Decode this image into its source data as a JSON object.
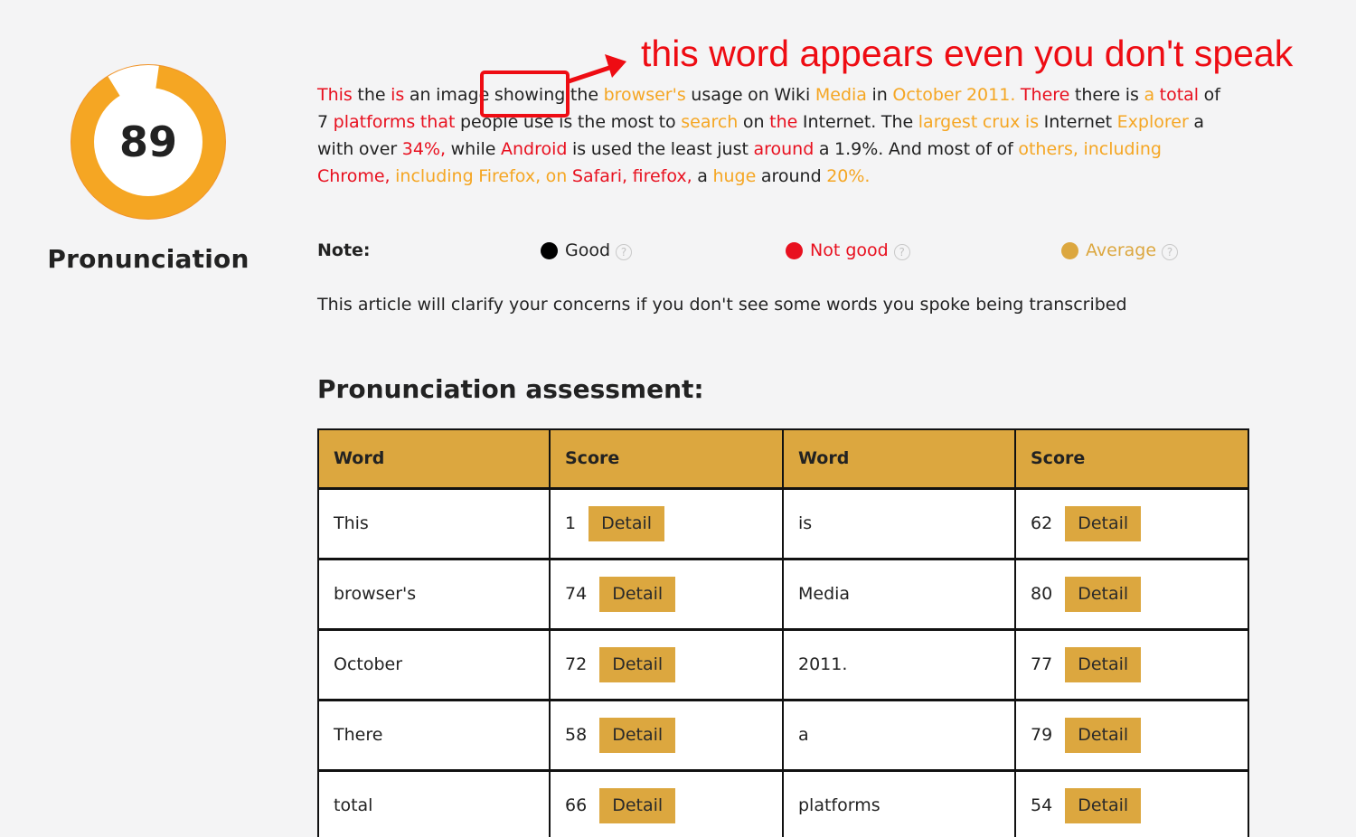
{
  "score": {
    "value": "89",
    "fraction": 0.89,
    "label": "Pronunciation",
    "ring_color": "#f5a623"
  },
  "transcript": [
    {
      "t": "This",
      "c": "red"
    },
    {
      "t": "the",
      "c": "normal"
    },
    {
      "t": "is",
      "c": "red"
    },
    {
      "t": "an",
      "c": "normal"
    },
    {
      "t": "image",
      "c": "normal"
    },
    {
      "t": "showing",
      "c": "normal"
    },
    {
      "t": "the",
      "c": "normal"
    },
    {
      "t": "browser's",
      "c": "orange"
    },
    {
      "t": "usage",
      "c": "normal"
    },
    {
      "t": "on",
      "c": "normal"
    },
    {
      "t": "Wiki",
      "c": "normal"
    },
    {
      "t": "Media",
      "c": "orange"
    },
    {
      "t": "in",
      "c": "normal"
    },
    {
      "t": "October",
      "c": "orange"
    },
    {
      "t": "2011.",
      "c": "orange"
    },
    {
      "t": "There",
      "c": "red"
    },
    {
      "t": "there",
      "c": "normal"
    },
    {
      "t": "is",
      "c": "normal"
    },
    {
      "t": "a",
      "c": "orange"
    },
    {
      "t": "total",
      "c": "red"
    },
    {
      "t": "of",
      "c": "normal"
    },
    {
      "t": "7",
      "c": "normal"
    },
    {
      "t": "platforms",
      "c": "red"
    },
    {
      "t": "that",
      "c": "red"
    },
    {
      "t": "people",
      "c": "normal"
    },
    {
      "t": "use",
      "c": "normal"
    },
    {
      "t": "is",
      "c": "normal"
    },
    {
      "t": "the",
      "c": "normal"
    },
    {
      "t": "most",
      "c": "normal"
    },
    {
      "t": "to",
      "c": "normal"
    },
    {
      "t": "search",
      "c": "orange"
    },
    {
      "t": "on",
      "c": "normal"
    },
    {
      "t": "the",
      "c": "red"
    },
    {
      "t": "Internet.",
      "c": "normal"
    },
    {
      "t": "The",
      "c": "normal"
    },
    {
      "t": "largest",
      "c": "orange"
    },
    {
      "t": "crux",
      "c": "orange"
    },
    {
      "t": "is",
      "c": "orange"
    },
    {
      "t": "Internet",
      "c": "normal"
    },
    {
      "t": "Explorer",
      "c": "orange"
    },
    {
      "t": "a",
      "c": "normal"
    },
    {
      "t": "with",
      "c": "normal"
    },
    {
      "t": "over",
      "c": "normal"
    },
    {
      "t": "34%,",
      "c": "red"
    },
    {
      "t": "while",
      "c": "normal"
    },
    {
      "t": "Android",
      "c": "red"
    },
    {
      "t": "is",
      "c": "normal"
    },
    {
      "t": "used",
      "c": "normal"
    },
    {
      "t": "the",
      "c": "normal"
    },
    {
      "t": "least",
      "c": "normal"
    },
    {
      "t": "just",
      "c": "normal"
    },
    {
      "t": "around",
      "c": "red"
    },
    {
      "t": "a",
      "c": "normal"
    },
    {
      "t": "1.9%.",
      "c": "normal"
    },
    {
      "t": "And",
      "c": "normal"
    },
    {
      "t": "most",
      "c": "normal"
    },
    {
      "t": "of",
      "c": "normal"
    },
    {
      "t": "of",
      "c": "normal"
    },
    {
      "t": "others,",
      "c": "orange"
    },
    {
      "t": "including",
      "c": "orange"
    },
    {
      "t": "Chrome,",
      "c": "red"
    },
    {
      "t": "including",
      "c": "orange"
    },
    {
      "t": "Firefox,",
      "c": "orange"
    },
    {
      "t": "on",
      "c": "orange"
    },
    {
      "t": "Safari,",
      "c": "red"
    },
    {
      "t": "firefox,",
      "c": "red"
    },
    {
      "t": "a",
      "c": "normal"
    },
    {
      "t": "huge",
      "c": "orange"
    },
    {
      "t": "around",
      "c": "normal"
    },
    {
      "t": "20%.",
      "c": "orange"
    }
  ],
  "annotation": {
    "text": "this word appears even you don't speak",
    "highlighted_word": "showing",
    "color": "#ee0c13"
  },
  "legend": {
    "title": "Note:",
    "items": [
      {
        "label": "Good",
        "color": "#000000",
        "text_color": "#222222"
      },
      {
        "label": "Not good",
        "color": "#e8101f",
        "text_color": "#e8101f"
      },
      {
        "label": "Average",
        "color": "#dca73f",
        "text_color": "#dca73f"
      }
    ],
    "help_glyph": "?"
  },
  "article_note": "This article will clarify your concerns if you don't see some words you spoke being transcribed",
  "section_title": "Pronunciation assessment:",
  "table": {
    "headers": [
      "Word",
      "Score",
      "Word",
      "Score"
    ],
    "detail_label": "Detail",
    "rows": [
      [
        {
          "word": "This",
          "score": "1"
        },
        {
          "word": "is",
          "score": "62"
        }
      ],
      [
        {
          "word": "browser's",
          "score": "74"
        },
        {
          "word": "Media",
          "score": "80"
        }
      ],
      [
        {
          "word": "October",
          "score": "72"
        },
        {
          "word": "2011.",
          "score": "77"
        }
      ],
      [
        {
          "word": "There",
          "score": "58"
        },
        {
          "word": "a",
          "score": "79"
        }
      ],
      [
        {
          "word": "total",
          "score": "66"
        },
        {
          "word": "platforms",
          "score": "54"
        }
      ]
    ]
  }
}
